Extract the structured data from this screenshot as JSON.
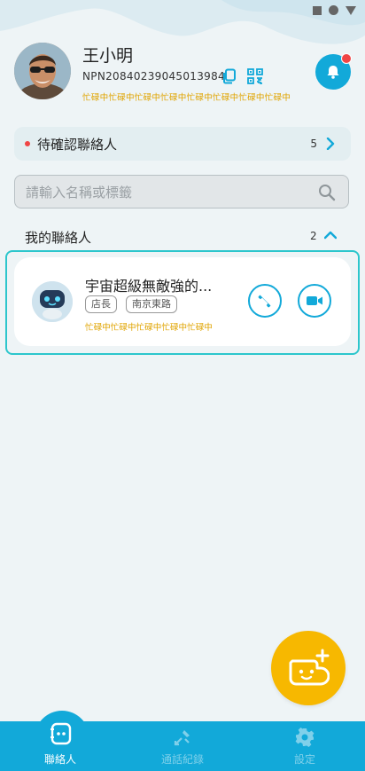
{
  "statusbar": {
    "icons": [
      "square-icon",
      "circle-icon",
      "triangle-icon"
    ]
  },
  "profile": {
    "name": "王小明",
    "id": "NPN20840239045013984",
    "status": "忙碌中忙碌中忙碌中忙碌中忙碌中忙碌中忙碌中忙碌中",
    "icons": {
      "copy": "copy-icon",
      "qr": "qr-code-icon",
      "bell": "bell-icon"
    }
  },
  "pending": {
    "label": "待確認聯絡人",
    "count": "5"
  },
  "search": {
    "placeholder": "請輸入名稱或標籤",
    "value": ""
  },
  "contacts_section": {
    "title": "我的聯絡人",
    "count": "2"
  },
  "contacts": [
    {
      "name": "宇宙超級無敵強的...",
      "tags": [
        "店長",
        "南京東路"
      ],
      "status": "忙碌中忙碌中忙碌中忙碌中忙碌中"
    }
  ],
  "tabs": [
    {
      "label": "聯絡人",
      "icon": "contacts-icon",
      "active": true
    },
    {
      "label": "通話紀錄",
      "icon": "call-log-icon",
      "active": false
    },
    {
      "label": "設定",
      "icon": "gear-icon",
      "active": false
    }
  ],
  "colors": {
    "accent": "#12a9d9",
    "fab": "#f7b800",
    "status": "#e0a400",
    "badge": "#f04545",
    "highlight": "#2cc6cc"
  }
}
